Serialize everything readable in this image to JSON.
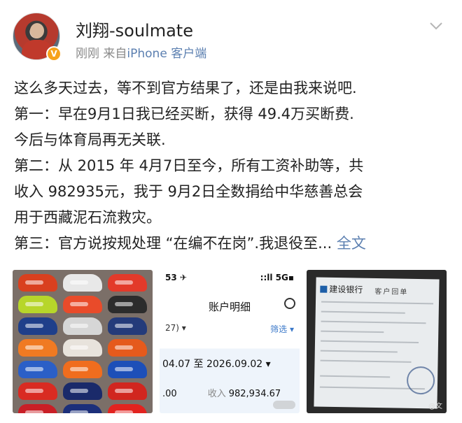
{
  "post": {
    "username": "刘翔-soulmate",
    "time": "刚刚",
    "source_prefix": "来自",
    "source_app": "iPhone 客户端",
    "lines": [
      "这么多天过去，等不到官方结果了，还是由我来说吧.",
      "第一：早在9月1日我已经买断，获得 49.4万买断费.",
      "今后与体育局再无关联.",
      "第二：从 2015 年 4月7日至今，所有工资补助等，共",
      "收入 982935元，我于 9月2日全数捐给中华慈善总会",
      "用于西藏泥石流救灾。",
      "第三：官方说按规处理 “在编不在岗”.我退役至..."
    ],
    "more_link": "全文"
  },
  "images": {
    "bank_app": {
      "status_left": "53 ✈",
      "status_right": "::ll 5G▪",
      "title": "账户明细",
      "left_text": "27) ▾",
      "filter": "筛选 ▾",
      "date_range": "04.07 至 2026.09.02 ▾",
      "amount_left": ".00",
      "income_label": "收入",
      "income_value": "982,934.67"
    },
    "receipt": {
      "bank_name": "建设银行",
      "doc_title": "客户回单",
      "watermark": "@文"
    }
  },
  "colors": {
    "link": "#5b7fb0",
    "verified": "#f7a21b"
  },
  "icons": {
    "chevron": "chevron-down-icon",
    "verified": "verified-badge-icon"
  }
}
